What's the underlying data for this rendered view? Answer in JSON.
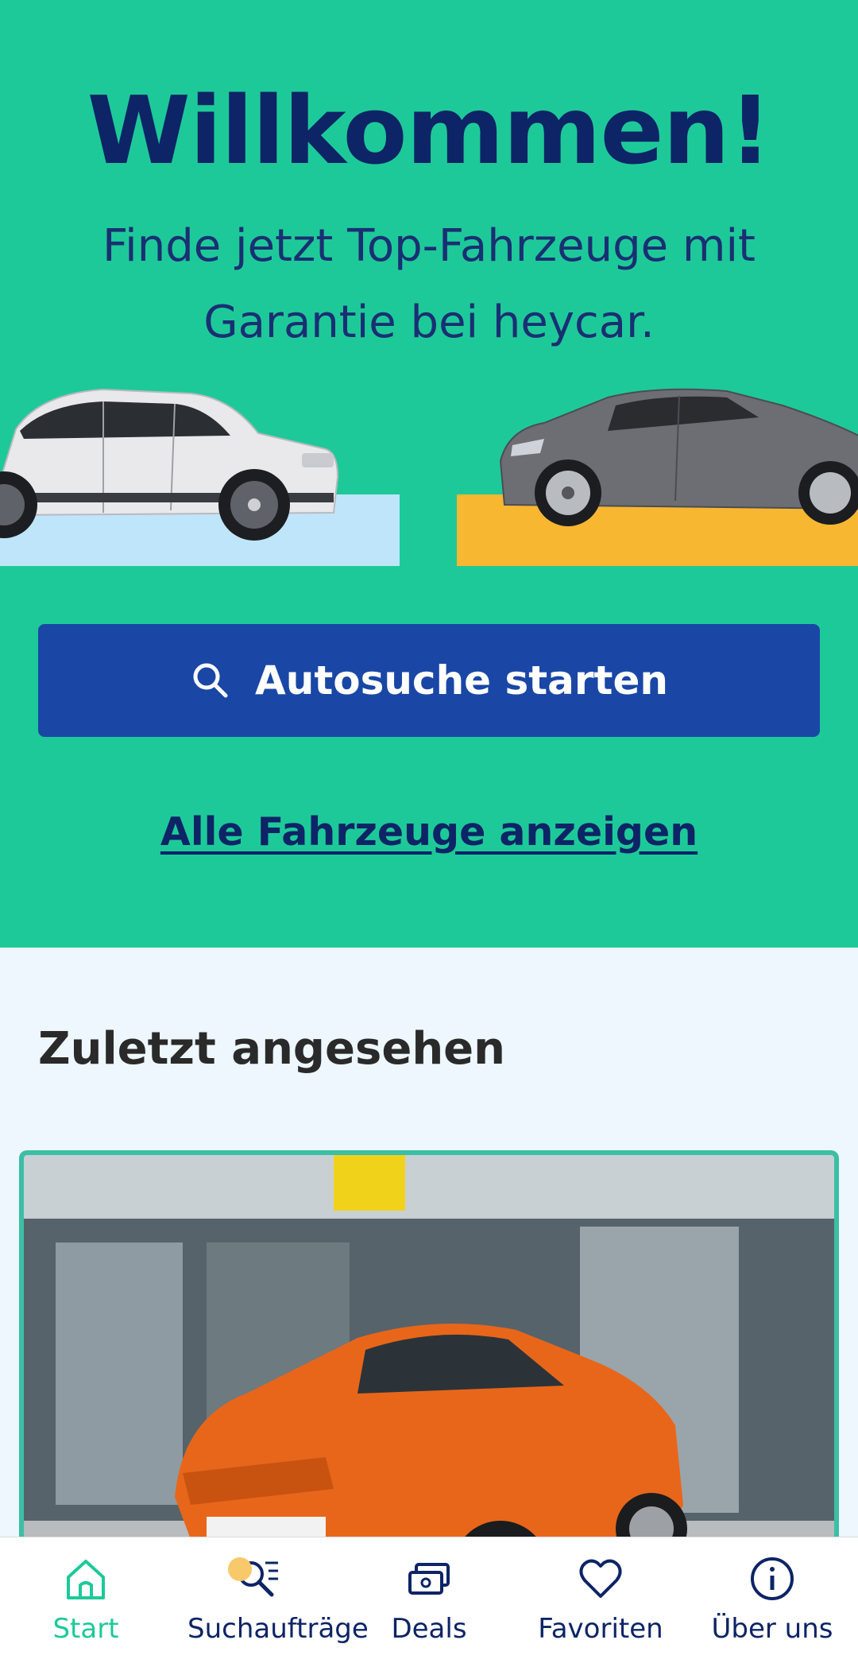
{
  "hero": {
    "title": "Willkommen!",
    "subtitle": "Finde jetzt Top-Fahrzeuge mit Garantie bei heycar.",
    "search_button_label": "Autosuche starten",
    "all_vehicles_link": "Alle Fahrzeuge anzeigen"
  },
  "recent": {
    "title": "Zuletzt angesehen"
  },
  "nav": {
    "items": [
      {
        "label": "Start",
        "icon": "home-icon",
        "active": true
      },
      {
        "label": "Suchaufträge",
        "icon": "saved-search-icon",
        "active": false
      },
      {
        "label": "Deals",
        "icon": "deals-icon",
        "active": false
      },
      {
        "label": "Favoriten",
        "icon": "heart-icon",
        "active": false
      },
      {
        "label": "Über uns",
        "icon": "info-icon",
        "active": false
      }
    ]
  },
  "colors": {
    "hero_bg": "#1ec999",
    "primary_button": "#1a47a6",
    "text_navy": "#0d2466",
    "active_nav": "#1ec999",
    "plate_left": "#bfe5fb",
    "plate_right": "#f7b731",
    "section_bg": "#eef7fd"
  }
}
